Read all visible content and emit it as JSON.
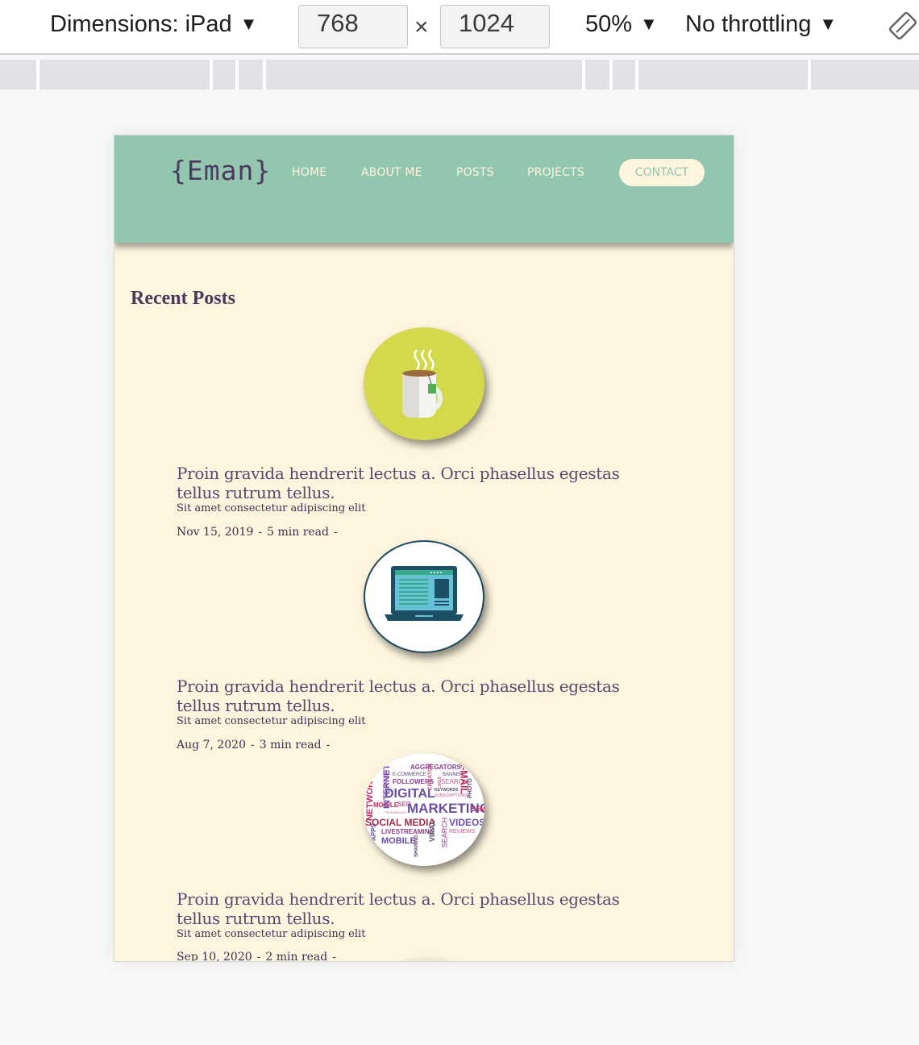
{
  "toolbar": {
    "dimensions_label": "Dimensions: iPad",
    "width": "768",
    "times": "×",
    "height": "1024",
    "zoom": "50%",
    "throttling": "No throttling"
  },
  "site": {
    "logo": "{Eman}",
    "nav": [
      "HOME",
      "ABOUT ME",
      "POSTS",
      "PROJECTS"
    ],
    "contact": "CONTACT",
    "colors": {
      "header": "#93c6ae",
      "page": "#fdf5de",
      "heading": "#4b3a5e"
    }
  },
  "recent_posts": {
    "title": "Recent Posts",
    "posts": [
      {
        "icon": "tea-cup-icon",
        "title": "Proin gravida hendrerit lectus a. Orci phasellus egestas tellus rutrum tellus.",
        "subtitle": "Sit amet consectetur adipiscing elit",
        "date": "Nov 15, 2019",
        "read_time": "5 min read"
      },
      {
        "icon": "laptop-icon",
        "title": "Proin gravida hendrerit lectus a. Orci phasellus egestas tellus rutrum tellus.",
        "subtitle": "Sit amet consectetur adipiscing elit",
        "date": "Aug 7, 2020",
        "read_time": "3 min read"
      },
      {
        "icon": "word-cloud-image",
        "title": "Proin gravida hendrerit lectus a. Orci phasellus egestas tellus rutrum tellus.",
        "subtitle": "Sit amet consectetur adipiscing elit",
        "date": "Sep 10, 2020",
        "read_time": "2 min read"
      }
    ]
  },
  "word_cloud": [
    "AGGREGATORS",
    "E-COMMERCE",
    "BANNER",
    "FOLLOWERS",
    "SEARCH",
    "DIGITAL",
    "KEYWORDS",
    "SUBSCRIPTIONS",
    "MOBILE",
    "SEO",
    "MARKETING",
    "SEM",
    "SOCIAL MEDIA",
    "VIDEOS",
    "LIVESTREAMING",
    "REVIEWS",
    "MOBILE",
    "NETWORK",
    "INTERNET",
    "BLOGS",
    "CREATOR",
    "E-MAIL",
    "PHOTO",
    "VIRAL",
    "SEARCH",
    "SHARING",
    "APPS",
    "TECHNOLOGY",
    "LIKES"
  ],
  "separator": "-"
}
